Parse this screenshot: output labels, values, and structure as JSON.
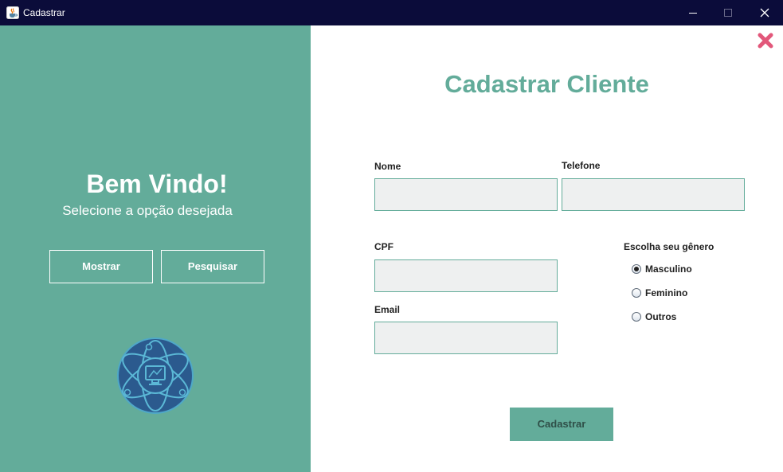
{
  "window": {
    "title": "Cadastrar",
    "icon": "java-cup-icon",
    "controls": [
      "minimize-icon",
      "maximize-icon",
      "close-icon"
    ]
  },
  "left_panel": {
    "background": "#63ac9a",
    "heading": "Bem Vindo!",
    "subtitle": "Selecione a opção desejada",
    "buttons": {
      "show_label": "Mostrar",
      "search_label": "Pesquisar"
    },
    "logo": "atom-computer-logo"
  },
  "form": {
    "title": "Cadastrar Cliente",
    "accent": "#63ac9a",
    "close_icon": "close-x-icon",
    "fields": {
      "name": {
        "label": "Nome",
        "value": ""
      },
      "phone": {
        "label": "Telefone",
        "value": ""
      },
      "cpf": {
        "label": "CPF",
        "value": ""
      },
      "email": {
        "label": "Email",
        "value": ""
      }
    },
    "gender": {
      "title": "Escolha seu gênero",
      "options": [
        {
          "label": "Masculino",
          "selected": true
        },
        {
          "label": "Feminino",
          "selected": false
        },
        {
          "label": "Outros",
          "selected": false
        }
      ]
    },
    "submit_label": "Cadastrar"
  }
}
